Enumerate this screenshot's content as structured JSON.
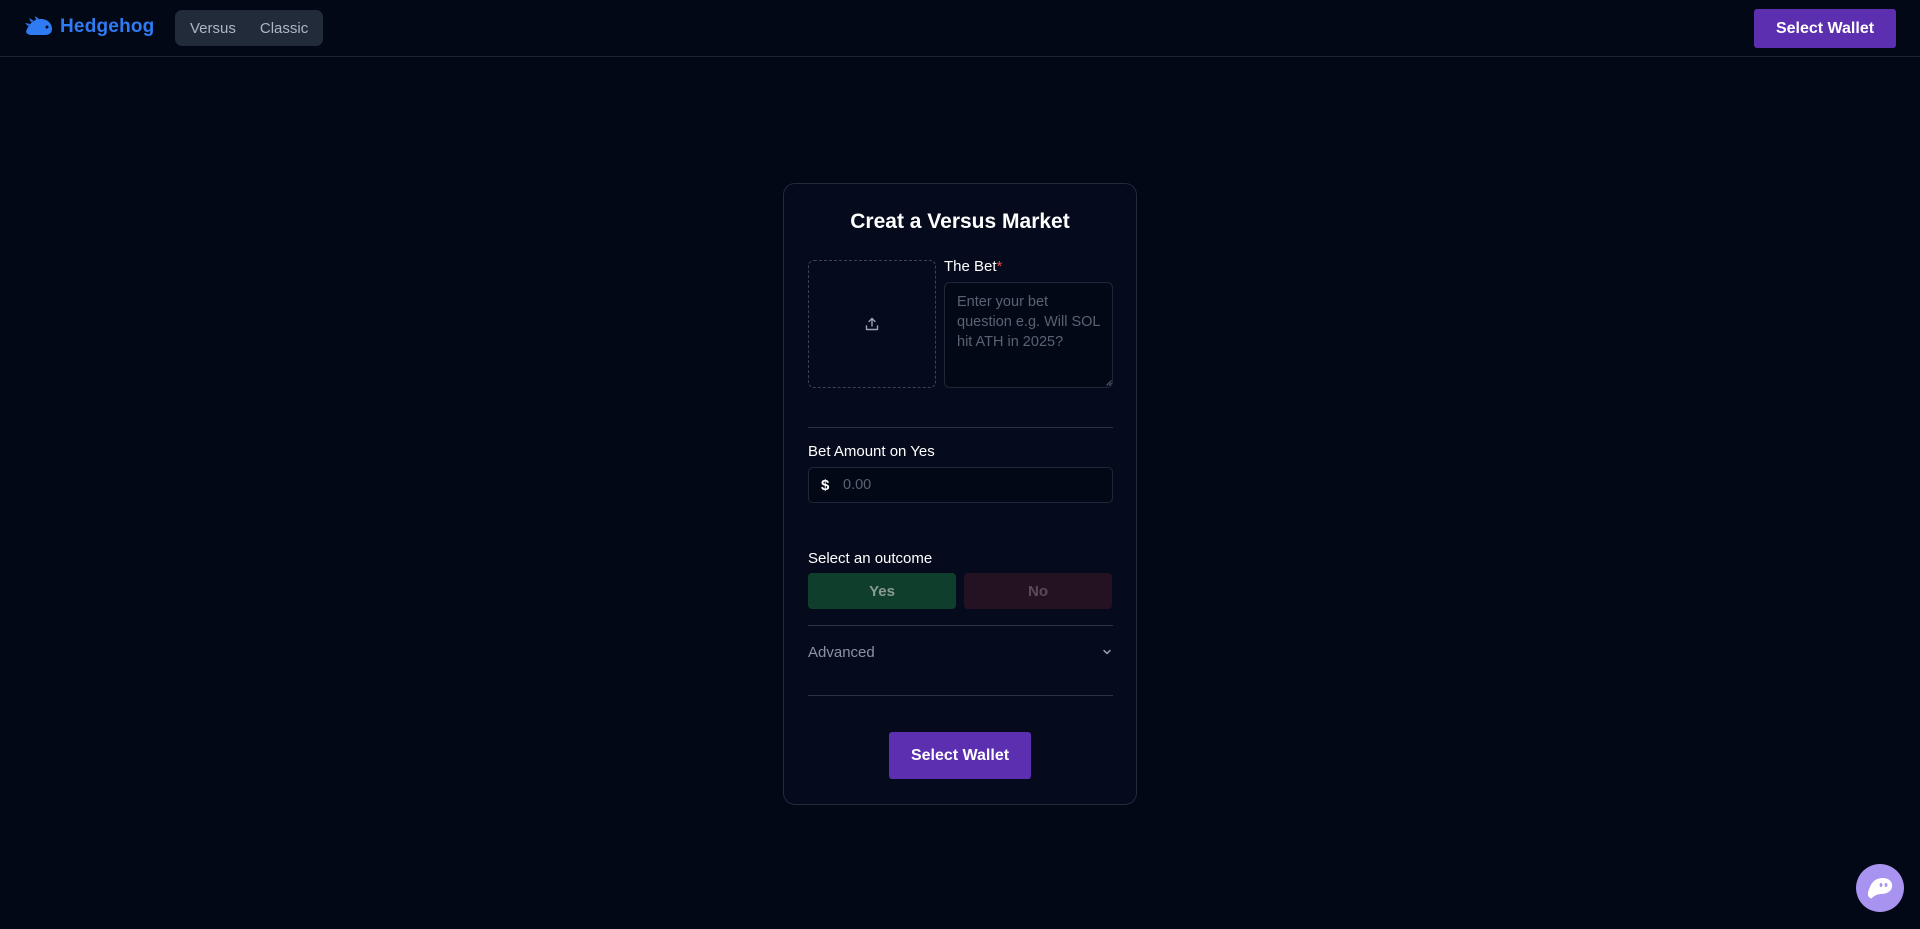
{
  "header": {
    "brand": "Hedgehog",
    "nav": [
      {
        "label": "Versus"
      },
      {
        "label": "Classic"
      }
    ],
    "wallet_button": "Select Wallet"
  },
  "form": {
    "title": "Creat a Versus Market",
    "bet_label": "The Bet",
    "bet_required_mark": "*",
    "bet_placeholder": "Enter your bet question e.g. Will SOL hit ATH in 2025?",
    "amount_label": "Bet Amount on Yes",
    "currency_symbol": "$",
    "amount_placeholder": "0.00",
    "outcome_label": "Select an outcome",
    "outcome_yes": "Yes",
    "outcome_no": "No",
    "advanced_label": "Advanced",
    "wallet_button": "Select Wallet"
  },
  "icons": {
    "logo": "hedgehog-logo-icon",
    "upload": "upload-icon",
    "chevron": "chevron-down-icon",
    "chat": "chat-ghost-icon"
  },
  "colors": {
    "background": "#030816",
    "brand": "#2e7bf3",
    "primary_button": "#5b2fb0",
    "yes_bg": "#0f3e2c",
    "no_bg": "#241222",
    "required": "#ef4444"
  }
}
